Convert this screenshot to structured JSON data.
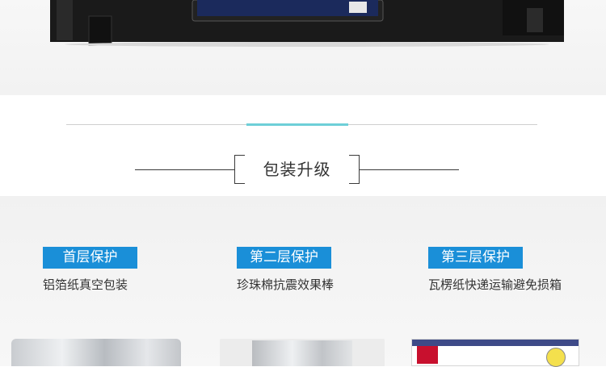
{
  "section": {
    "title": "包装升级"
  },
  "layers": [
    {
      "badge": "首层保护",
      "description": "铝箔纸真空包装"
    },
    {
      "badge": "第二层保护",
      "description": "珍珠棉抗震效果棒"
    },
    {
      "badge": "第三层保护",
      "description": "瓦楞纸快递运输避免损箱"
    }
  ],
  "colors": {
    "badge": "#1a8fd8",
    "accent_line": "#6ecfd8",
    "text": "#333333"
  }
}
